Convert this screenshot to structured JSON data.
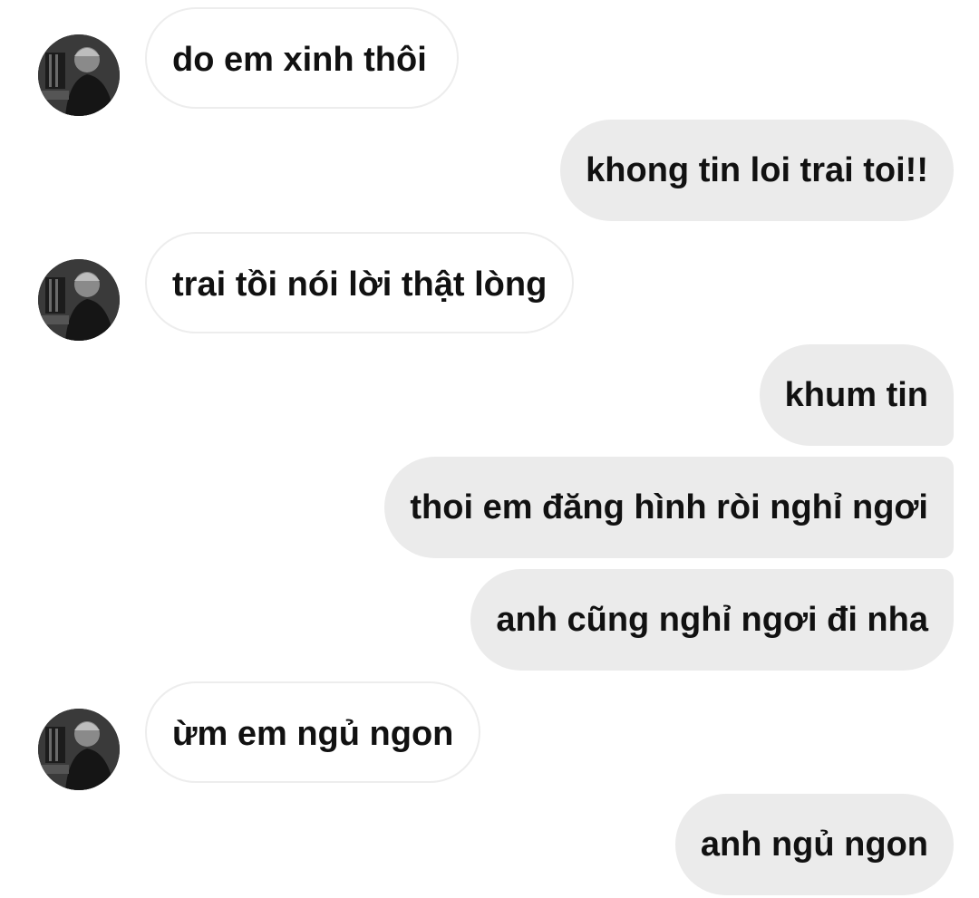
{
  "conversation": {
    "messages": [
      {
        "sender": "them",
        "text": "do em xinh thôi"
      },
      {
        "sender": "me",
        "text": "khong tin loi trai toi!!"
      },
      {
        "sender": "them",
        "text": "trai tồi nói lời thật lòng"
      },
      {
        "sender": "me",
        "text": "khum tin"
      },
      {
        "sender": "me",
        "text": "thoi em đăng hình ròi nghỉ ngơi "
      },
      {
        "sender": "me",
        "text": "anh cũng nghỉ ngơi đi nha"
      },
      {
        "sender": "them",
        "text": "ừm em ngủ ngon"
      },
      {
        "sender": "me",
        "text": "anh ngủ ngon"
      }
    ]
  },
  "colors": {
    "incoming_bubble_bg": "#ffffff",
    "incoming_bubble_border": "#ededed",
    "outgoing_bubble_bg": "#ebebeb",
    "text": "#111111"
  },
  "icons": {
    "avatar": "profile-photo-avatar"
  }
}
